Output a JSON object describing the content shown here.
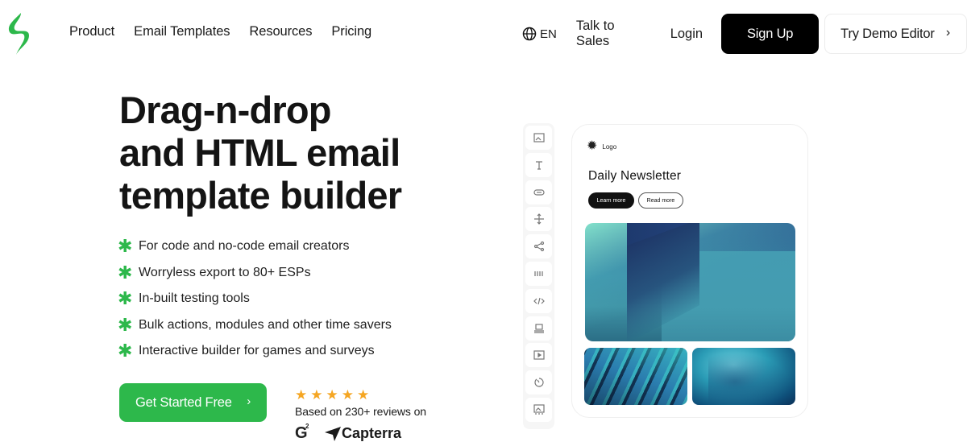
{
  "header": {
    "logo_icon": "stripo-s-logo",
    "nav": [
      {
        "label": "Product"
      },
      {
        "label": "Email Templates"
      },
      {
        "label": "Resources"
      },
      {
        "label": "Pricing"
      }
    ],
    "language": {
      "icon": "globe-icon",
      "label": "EN"
    },
    "talk_to_sales": "Talk to Sales",
    "login": "Login",
    "signup": "Sign Up",
    "demo": {
      "label": "Try Demo Editor",
      "icon": "chevron-right-icon"
    }
  },
  "hero": {
    "title_lines": [
      "Drag-n-drop",
      "and HTML email",
      "template builder"
    ],
    "features": [
      "For code and no-code email creators",
      "Worryless export to 80+ ESPs",
      "In-built testing tools",
      "Bulk actions, modules and other time savers",
      "Interactive builder for games and surveys"
    ],
    "feature_bullet": "✱",
    "cta": {
      "label": "Get Started Free",
      "icon": "chevron-right-icon"
    },
    "rating": {
      "stars": 5,
      "star_glyph": "★",
      "text": "Based on 230+ reviews on",
      "badges": [
        "G2",
        "Capterra"
      ]
    }
  },
  "toolbar": {
    "tools": [
      {
        "name": "image-block"
      },
      {
        "name": "text-block"
      },
      {
        "name": "button-block"
      },
      {
        "name": "spacer-block"
      },
      {
        "name": "social-block"
      },
      {
        "name": "divider-block"
      },
      {
        "name": "html-block"
      },
      {
        "name": "menu-block"
      },
      {
        "name": "video-block"
      },
      {
        "name": "timer-block"
      },
      {
        "name": "banner-block"
      }
    ]
  },
  "preview": {
    "logo_text": "Logo",
    "title": "Daily Newsletter",
    "primary_button": "Learn more",
    "secondary_button": "Read more"
  },
  "colors": {
    "brand_green": "#2db84b",
    "star": "#f5a623",
    "black": "#000000"
  }
}
